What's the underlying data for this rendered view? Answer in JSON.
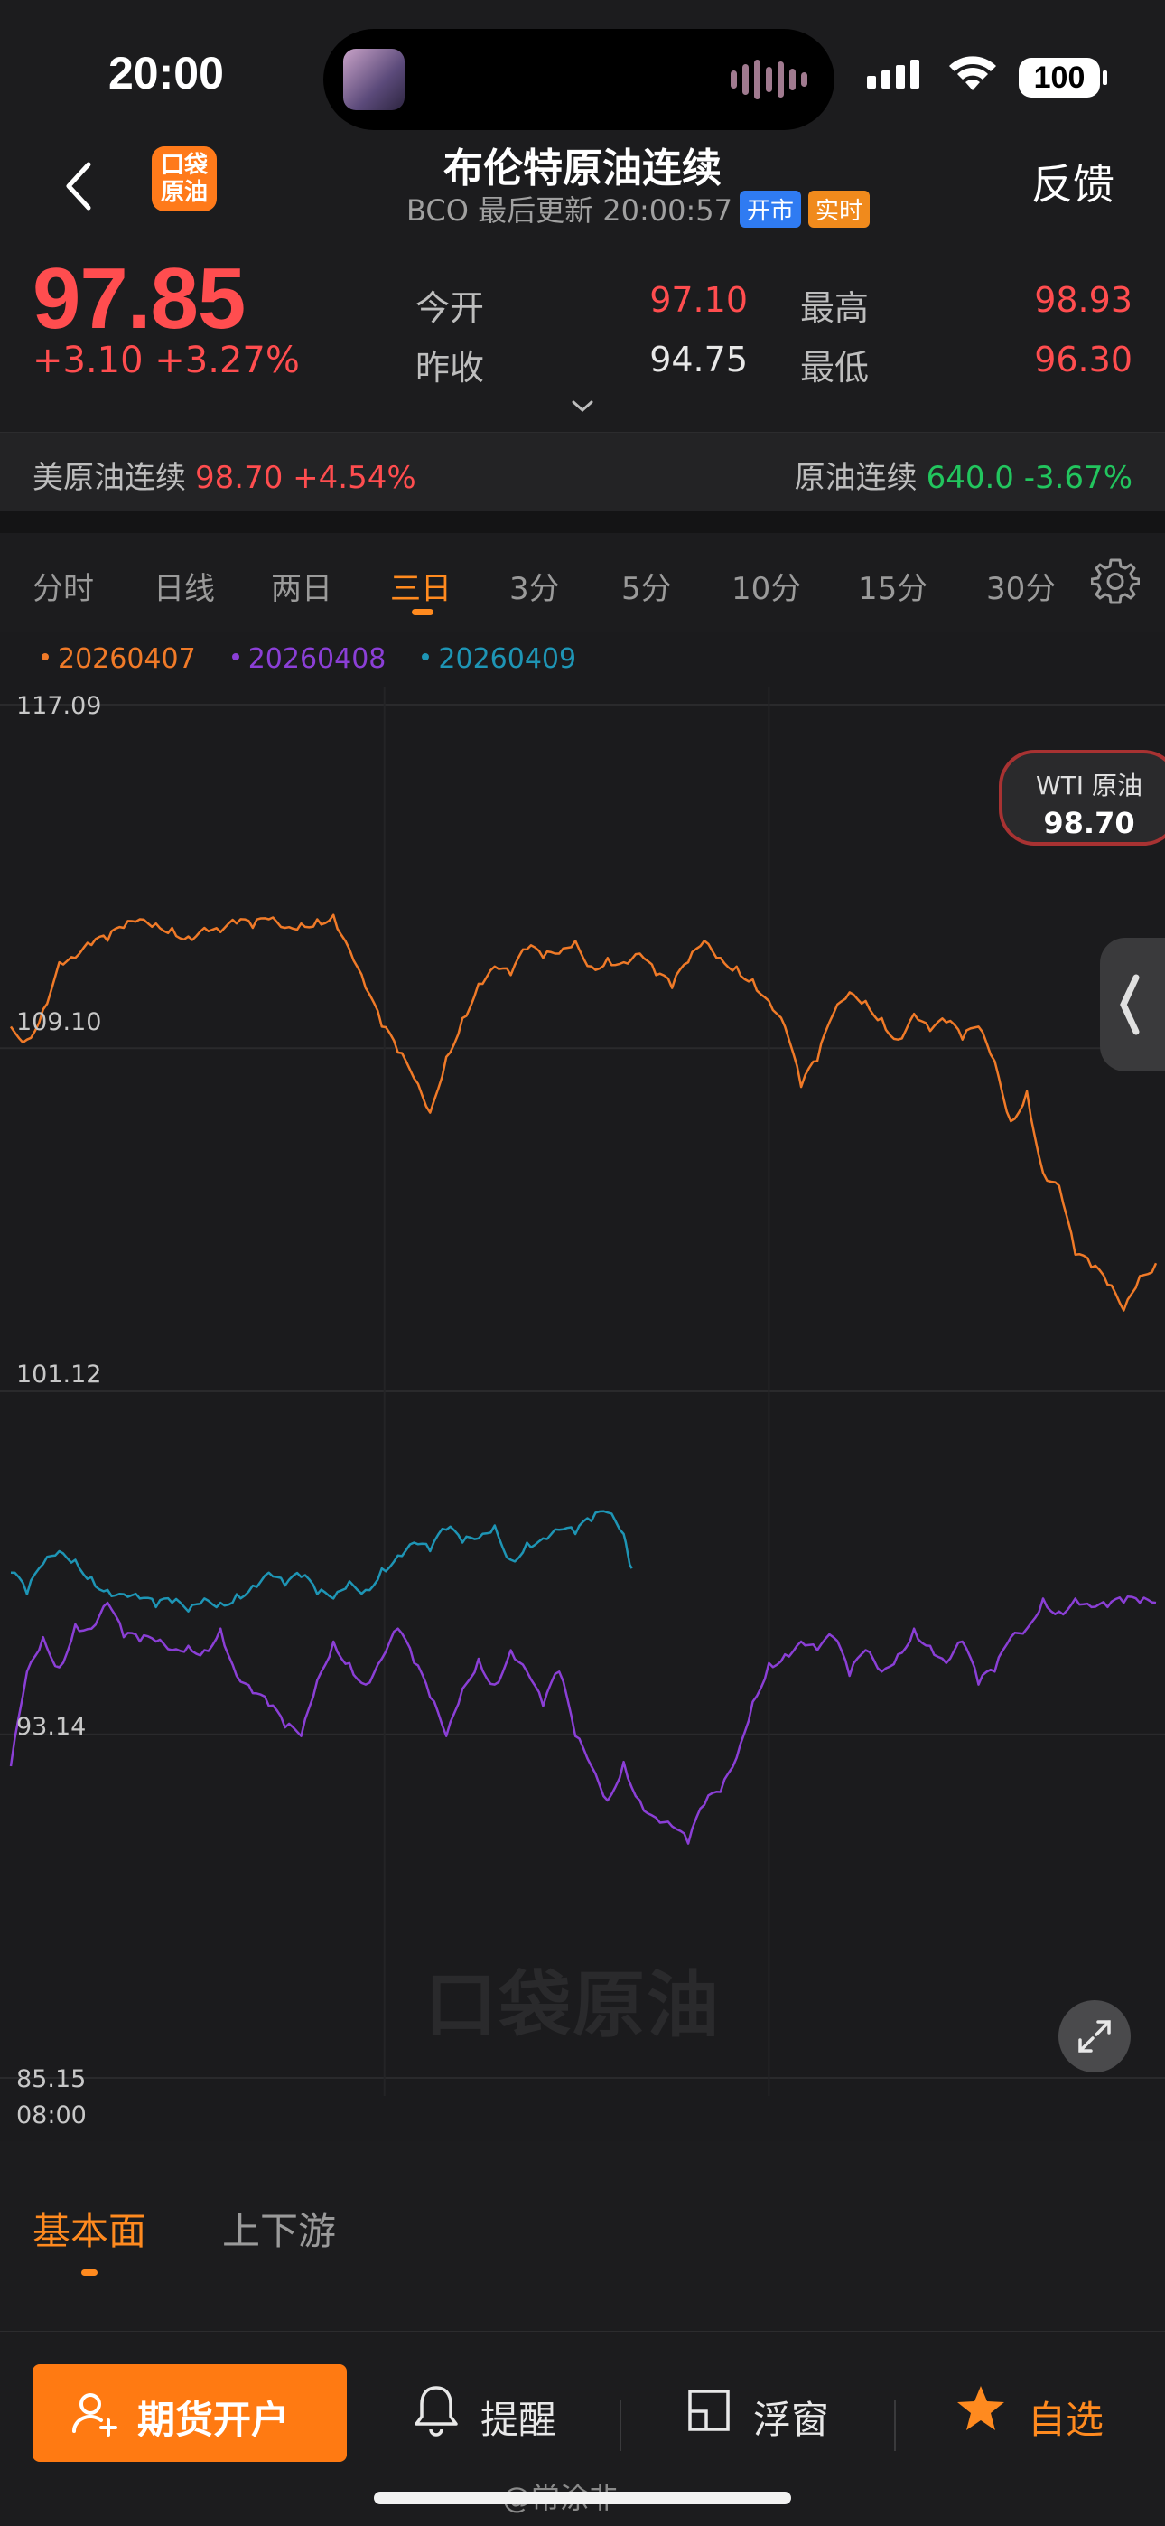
{
  "status_bar": {
    "time": "20:00",
    "battery": "100"
  },
  "nav": {
    "logo_text_line1": "口袋",
    "logo_text_line2": "原油",
    "title": "布伦特原油连续",
    "subtitle": "BCO 最后更新 20:00:57",
    "badge_open": "开市",
    "badge_realtime": "实时",
    "feedback": "反馈"
  },
  "quote": {
    "price": "97.85",
    "change": "+3.10 +3.27%",
    "open_label": "今开",
    "open_value": "97.10",
    "high_label": "最高",
    "high_value": "98.93",
    "prev_label": "昨收",
    "prev_value": "94.75",
    "low_label": "最低",
    "low_value": "96.30"
  },
  "related": {
    "left_name": "美原油连续",
    "left_value": "98.70 +4.54%",
    "right_name": "原油连续",
    "right_value": "640.0 -3.67%"
  },
  "tabs": [
    "分时",
    "日线",
    "两日",
    "三日",
    "3分",
    "5分",
    "10分",
    "15分",
    "30分"
  ],
  "active_tab": "三日",
  "chart_data": {
    "type": "line",
    "series": [
      {
        "name": "20260407",
        "color": "#f07a28",
        "x": [
          0,
          10,
          20,
          30,
          40,
          50,
          60,
          70,
          80,
          90,
          100,
          110,
          120,
          130,
          140,
          150,
          160,
          170,
          180,
          190,
          200,
          210,
          220,
          230,
          240,
          250,
          260,
          270,
          280,
          290,
          300,
          310,
          320,
          330,
          340,
          350,
          360,
          370,
          380,
          390,
          400,
          410,
          420,
          430,
          440,
          450,
          460,
          470,
          480,
          490,
          500,
          510,
          520,
          530,
          540,
          550,
          560,
          570,
          580,
          590,
          600,
          610,
          620,
          630,
          640,
          650,
          660,
          670,
          680,
          690,
          700,
          710
        ],
        "y": [
          109.6,
          109.3,
          110.0,
          111.1,
          111.2,
          111.5,
          111.6,
          111.9,
          112.1,
          112.0,
          111.9,
          111.7,
          111.9,
          111.8,
          112.0,
          111.9,
          112.1,
          111.9,
          112.0,
          112.1,
          112.2,
          111.4,
          110.5,
          109.6,
          109.0,
          108.4,
          107.6,
          108.9,
          109.8,
          110.6,
          111.0,
          110.8,
          111.4,
          111.2,
          111.3,
          111.6,
          111.0,
          111.2,
          111.1,
          111.3,
          110.8,
          110.5,
          111.1,
          111.6,
          111.2,
          111.0,
          110.7,
          110.2,
          109.6,
          108.2,
          108.8,
          109.9,
          110.4,
          110.2,
          109.8,
          109.3,
          109.9,
          109.5,
          109.7,
          109.3,
          109.6,
          108.8,
          107.4,
          108.1,
          106.2,
          105.9,
          104.3,
          104.0,
          103.6,
          103.0,
          103.8,
          104.1
        ]
      },
      {
        "name": "20260408",
        "color": "#8b3fd6",
        "x": [
          0,
          10,
          20,
          30,
          40,
          50,
          60,
          70,
          80,
          90,
          100,
          110,
          120,
          130,
          140,
          150,
          160,
          170,
          180,
          190,
          200,
          210,
          220,
          230,
          240,
          250,
          260,
          270,
          280,
          290,
          300,
          310,
          320,
          330,
          340,
          350,
          360,
          370,
          380,
          390,
          400,
          410,
          420,
          430,
          440,
          450,
          460,
          470,
          480,
          490,
          500,
          510,
          520,
          530,
          540,
          550,
          560,
          570,
          580,
          590,
          600,
          610,
          620,
          630,
          640,
          650,
          660,
          670,
          680,
          690,
          700,
          710
        ],
        "y": [
          92.4,
          94.6,
          95.4,
          94.7,
          95.7,
          95.6,
          96.2,
          95.4,
          95.3,
          95.3,
          95.1,
          95.2,
          95.1,
          95.6,
          94.5,
          94.1,
          93.8,
          93.3,
          93.1,
          94.4,
          95.3,
          94.8,
          94.3,
          94.9,
          95.6,
          94.8,
          94.0,
          93.1,
          94.2,
          94.9,
          94.3,
          95.1,
          94.6,
          93.8,
          94.6,
          93.1,
          92.4,
          91.6,
          92.5,
          91.6,
          91.2,
          91.0,
          90.6,
          91.5,
          91.8,
          92.6,
          93.9,
          94.8,
          95.0,
          95.3,
          95.1,
          95.4,
          94.5,
          95.1,
          94.6,
          95.0,
          95.6,
          95.2,
          94.8,
          95.3,
          94.3,
          94.6,
          95.4,
          95.6,
          96.3,
          96.0,
          96.3,
          96.1,
          96.1,
          96.2,
          96.2,
          96.2
        ]
      },
      {
        "name": "20260409",
        "color": "#1e95b5",
        "x": [
          0,
          10,
          20,
          30,
          40,
          50,
          60,
          70,
          80,
          90,
          100,
          110,
          120,
          130,
          140,
          150,
          160,
          170,
          180,
          190,
          200,
          210,
          220,
          230,
          240,
          250,
          260,
          270,
          280,
          290,
          300,
          310,
          320,
          330,
          340,
          350,
          360,
          370,
          380,
          385
        ],
        "y": [
          96.9,
          96.4,
          97.1,
          97.4,
          97.2,
          96.8,
          96.5,
          96.4,
          96.3,
          96.1,
          96.2,
          96.0,
          96.3,
          96.2,
          96.4,
          96.6,
          96.9,
          96.6,
          96.8,
          96.4,
          96.3,
          96.7,
          96.5,
          97.0,
          97.3,
          97.6,
          97.4,
          97.9,
          97.6,
          97.7,
          98.0,
          97.2,
          97.6,
          97.7,
          97.9,
          97.8,
          98.1,
          98.3,
          97.8,
          97.0
        ]
      }
    ],
    "yticks": [
      "117.09",
      "109.10",
      "101.12",
      "93.14",
      "85.15"
    ],
    "ylim": [
      85.15,
      117.09
    ],
    "xstart_label": "08:00",
    "grid": true,
    "legend_position": "top-left"
  },
  "chart_overlay": {
    "wti_label": "WTI 原油",
    "wti_value": "98.70",
    "watermark": "口袋原油"
  },
  "sub_tabs": [
    "基本面",
    "上下游"
  ],
  "bottom_bar": {
    "open_account": "期货开户",
    "alert": "提醒",
    "float_window": "浮窗",
    "watchlist": "自选"
  },
  "credit": "@常涂非",
  "colors": {
    "up": "#ff4d4f",
    "down": "#22c55e",
    "accent": "#ff8a1f"
  }
}
